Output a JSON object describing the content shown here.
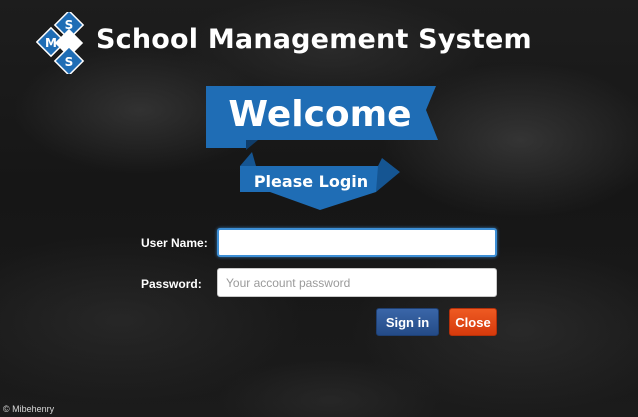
{
  "header": {
    "logo_letters": [
      "M",
      "S",
      "S"
    ],
    "app_title": "School Management System"
  },
  "banner": {
    "welcome": "Welcome",
    "please_login": "Please Login"
  },
  "form": {
    "username_label": "User Name:",
    "username_value": "",
    "password_label": "Password:",
    "password_placeholder": "Your account password"
  },
  "buttons": {
    "signin_label": "Sign in",
    "close_label": "Close"
  },
  "footer": {
    "copyright": "© Mibehenry"
  },
  "colors": {
    "brand_blue": "#1f6db5",
    "signin_blue": "#2c5595",
    "close_orange": "#e4461a",
    "focus_blue": "#3d8fd6"
  }
}
